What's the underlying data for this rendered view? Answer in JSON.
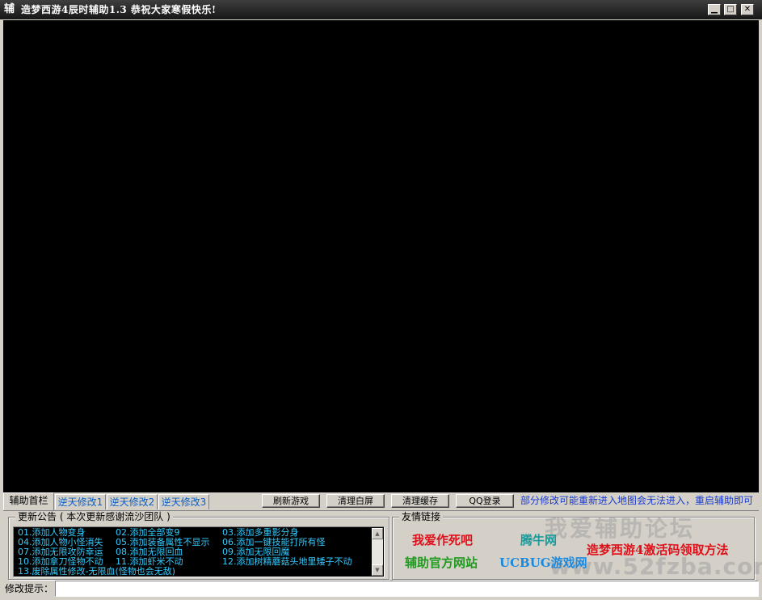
{
  "window": {
    "icon_glyph": "辅",
    "title": "造梦西游4辰时辅助1.3   恭祝大家寒假快乐!",
    "controls": {
      "minimize": "▁",
      "maximize": "□",
      "close": "✕"
    }
  },
  "tabs": [
    {
      "label": "辅助首栏",
      "active": true
    },
    {
      "label": "逆天修改1",
      "active": false
    },
    {
      "label": "逆天修改2",
      "active": false
    },
    {
      "label": "逆天修改3",
      "active": false
    }
  ],
  "toolbar": {
    "refresh_label": "刷新游戏",
    "clear_white_label": "清理白屏",
    "clear_cache_label": "清理缓存",
    "qq_login_label": "QQ登录",
    "hint": "部分修改可能重新进入地图会无法进入，重启辅助即可"
  },
  "notice": {
    "title": "更新公告 ( 本次更新感谢流沙团队 )",
    "lines": [
      "01.添加人物变身",
      "02.添加全部变9",
      "03.添加多重影分身",
      "04.添加人物小怪消失",
      "05.添加装备属性不显示",
      "06.添加一键技能打所有怪",
      "07.添加无限攻防幸运",
      "08.添加无限回血",
      "09.添加无限回魔",
      "10.添加拿刀怪物不动",
      "11.添加虾米不动",
      "12.添加树精蘑菇头地里矮子不动",
      "13.废除属性修改-无限血(怪物也会无敌)"
    ],
    "text_color": "#33ccff"
  },
  "links": {
    "title": "友情链接",
    "items": [
      {
        "label": "我爱作死吧",
        "color": "#e0101a"
      },
      {
        "label": "腾牛网",
        "color": "#1a9a9a"
      },
      {
        "label": "造梦西游4激活码领取方法",
        "color": "#e0101a"
      },
      {
        "label": "辅助官方网站",
        "color": "#1e9a1e"
      },
      {
        "label": "UCBUG游戏网",
        "color": "#1a8ae0"
      }
    ]
  },
  "watermark": {
    "line1": "我爱辅助论坛",
    "line2": "www.52fzba.com"
  },
  "status": {
    "label": "修改提示：",
    "value": ""
  }
}
